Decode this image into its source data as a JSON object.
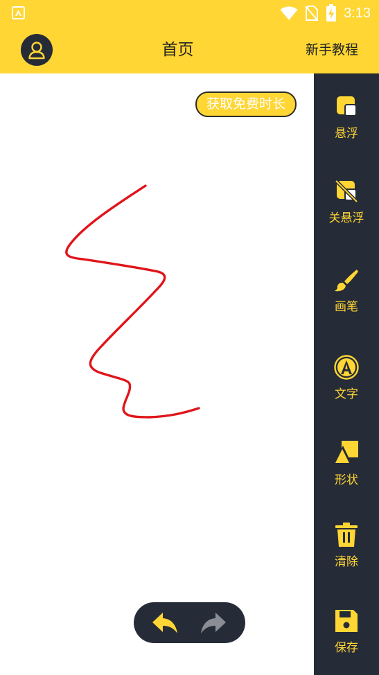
{
  "status_bar": {
    "time": "3:13"
  },
  "header": {
    "title": "首页",
    "tutorial": "新手教程"
  },
  "canvas": {
    "free_time_button": "获取免费时长",
    "stroke_color": "#E0151B"
  },
  "toolbar": [
    {
      "label": "悬浮",
      "icon": "float-window-icon"
    },
    {
      "label": "关悬浮",
      "icon": "float-off-icon"
    },
    {
      "label": "画笔",
      "icon": "brush-icon"
    },
    {
      "label": "文字",
      "icon": "text-a-icon"
    },
    {
      "label": "形状",
      "icon": "shape-icon"
    },
    {
      "label": "清除",
      "icon": "trash-icon"
    },
    {
      "label": "保存",
      "icon": "save-icon"
    }
  ],
  "colors": {
    "accent": "#FFD633",
    "dark": "#262B38",
    "redo_disabled": "#8A8D94"
  }
}
